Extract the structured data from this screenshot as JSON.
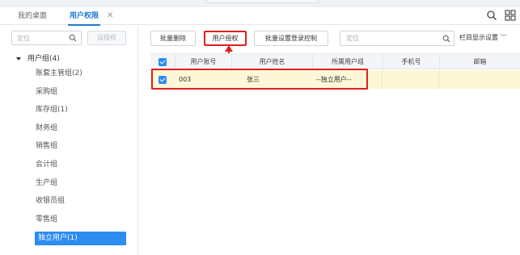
{
  "tabs": [
    {
      "label": "我的桌面"
    },
    {
      "label": "用户权限",
      "active": true,
      "close": "✕"
    }
  ],
  "top_icons": [
    "search-icon",
    "grid-icon"
  ],
  "left_panel": {
    "search_placeholder": "定位",
    "grant_button": "设授权",
    "tree_root": "用户组(4)",
    "tree_items": [
      "账套主管组(2)",
      "采购组",
      "库存组(1)",
      "财务组",
      "销售组",
      "会计组",
      "生产组",
      "收银员组",
      "零售组",
      "独立用户(1)"
    ],
    "selected_item": "独立用户(1)"
  },
  "toolbar": {
    "batch_delete": "批量删除",
    "user_authorize": "用户授权",
    "batch_login_control": "批量设置登录控制",
    "search_placeholder": "定位",
    "column_settings": "栏目显示设置",
    "chevron": "﹀"
  },
  "table": {
    "headers": [
      "用户账号",
      "用户姓名",
      "所属用户组",
      "手机号",
      "邮箱"
    ],
    "rows": [
      {
        "checked": true,
        "account": "003",
        "name": "张三",
        "group": "--独立用户--",
        "phone": "",
        "email": ""
      }
    ]
  },
  "colors": {
    "accent": "#2d8cf0",
    "tab_active": "#1f78d1",
    "highlight_red": "#e02020",
    "row_highlight": "#fdf7d8"
  }
}
